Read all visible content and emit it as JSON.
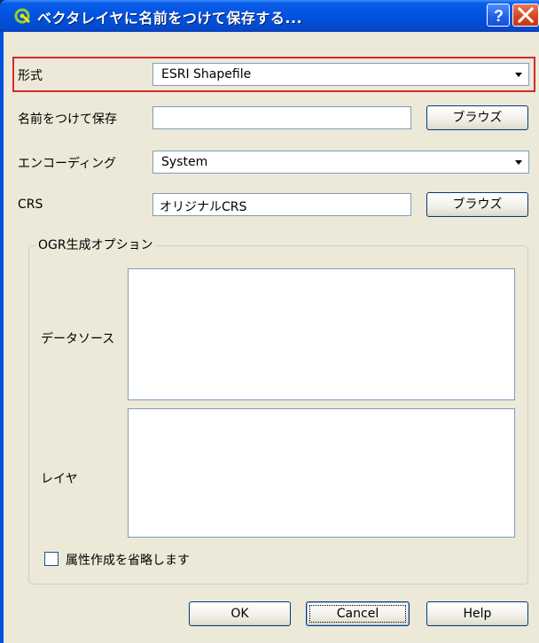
{
  "window": {
    "title": "ベクタレイヤに名前をつけて保存する...",
    "help_symbol": "?",
    "close_symbol": "X",
    "title_icon": "qgis-logo-icon"
  },
  "form": {
    "format_label": "形式",
    "format_value": "ESRI Shapefile",
    "save_as_label": "名前をつけて保存",
    "save_as_value": "",
    "browse_label": "ブラウズ",
    "encoding_label": "エンコーディング",
    "encoding_value": "System",
    "crs_label": "CRS",
    "crs_value": "オリジナルCRS",
    "crs_browse_label": "ブラウズ"
  },
  "ogr": {
    "group_title": "OGR生成オプション",
    "datasource_label": "データソース",
    "layer_label": "レイヤ",
    "datasource_value": "",
    "layer_value": "",
    "skip_attributes_label": "属性作成を省略します",
    "skip_attributes_checked": false
  },
  "buttons": {
    "ok": "OK",
    "cancel": "Cancel",
    "help": "Help"
  },
  "colors": {
    "title_bar": "#0052df",
    "dialog_bg": "#ece9d8",
    "highlight": "#d22a2a"
  }
}
